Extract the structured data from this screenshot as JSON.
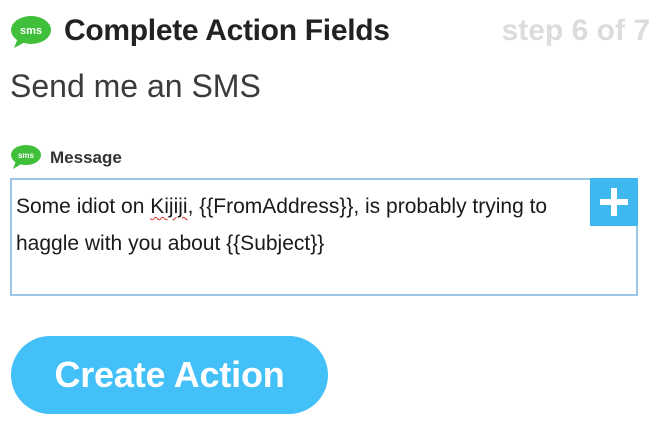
{
  "header": {
    "icon": "sms-icon",
    "icon_text": "sms",
    "title": "Complete Action Fields",
    "step": "step 6 of 7"
  },
  "action": {
    "name": "Send me an SMS"
  },
  "field": {
    "icon": "sms-icon",
    "icon_text": "sms",
    "label": "Message",
    "value_parts": {
      "before": "Some idiot on ",
      "misspelled": "Kijiji",
      "after": ", {{FromAddress}}, is probably trying to haggle with you about {{Subject}}"
    },
    "add_ingredient_icon": "plus-icon"
  },
  "buttons": {
    "create_action": "Create Action"
  },
  "colors": {
    "sms_green": "#3fbf3a",
    "accent_blue": "#42c0f7",
    "plus_blue": "#3fb8ef",
    "box_border": "#9ec4e8",
    "step_gray": "#dcdcdc"
  }
}
